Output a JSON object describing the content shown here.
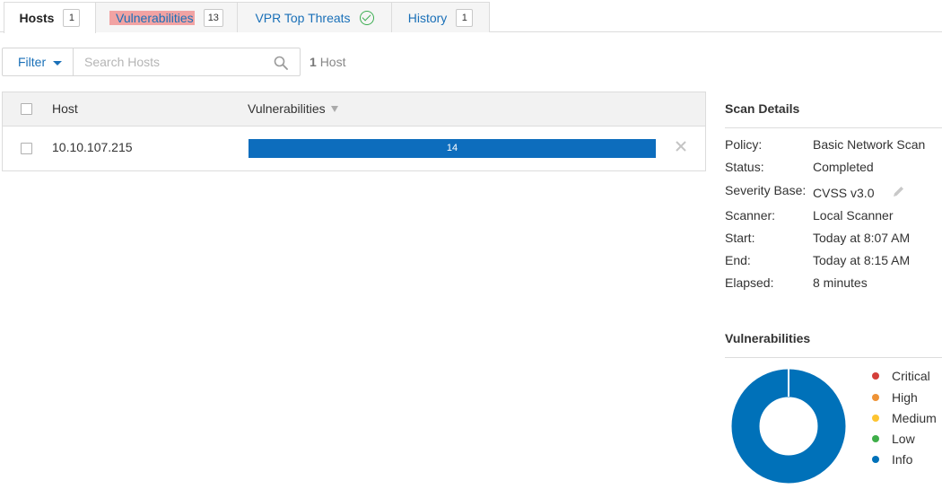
{
  "tabs": {
    "hosts": {
      "label": "Hosts",
      "count": "1"
    },
    "vulnerabilities": {
      "label": "Vulnerabilities",
      "count": "13"
    },
    "vpr": {
      "label": "VPR Top Threats"
    },
    "history": {
      "label": "History",
      "count": "1"
    }
  },
  "toolbar": {
    "filter_label": "Filter",
    "search_placeholder": "Search Hosts",
    "host_count_number": "1",
    "host_count_label": "Host"
  },
  "table": {
    "headers": {
      "host": "Host",
      "vulnerabilities": "Vulnerabilities"
    },
    "rows": [
      {
        "host": "10.10.107.215",
        "vuln_count": "14"
      }
    ]
  },
  "scan_details": {
    "title": "Scan Details",
    "rows": [
      {
        "label": "Policy:",
        "value": "Basic Network Scan"
      },
      {
        "label": "Status:",
        "value": "Completed"
      },
      {
        "label": "Severity Base:",
        "value": "CVSS v3.0"
      },
      {
        "label": "Scanner:",
        "value": "Local Scanner"
      },
      {
        "label": "Start:",
        "value": "Today at 8:07 AM"
      },
      {
        "label": "End:",
        "value": "Today at 8:15 AM"
      },
      {
        "label": "Elapsed:",
        "value": "8 minutes"
      }
    ]
  },
  "vuln_chart": {
    "title": "Vulnerabilities",
    "legend": [
      {
        "label": "Critical",
        "color": "#d43f3a"
      },
      {
        "label": "High",
        "color": "#ee9336"
      },
      {
        "label": "Medium",
        "color": "#fdc431"
      },
      {
        "label": "Low",
        "color": "#3fae49"
      },
      {
        "label": "Info",
        "color": "#0071b9"
      }
    ],
    "info_share": 1.0
  },
  "colors": {
    "accent": "#1a70b8",
    "bar": "#0d6dbd",
    "highlight": "#f1a3a3"
  },
  "icons": [
    "check-circle-icon",
    "caret-down-icon",
    "search-icon",
    "sort-down-icon",
    "remove-icon",
    "pencil-icon"
  ]
}
